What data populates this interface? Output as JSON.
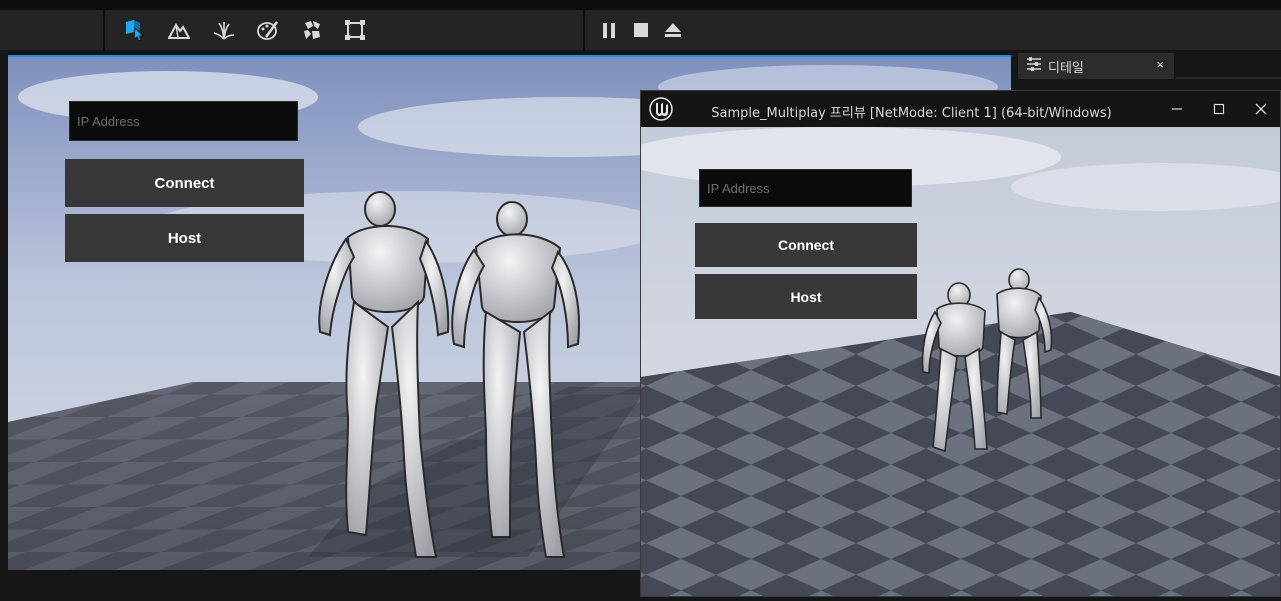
{
  "toolbar": {
    "modes": [
      {
        "icon": "select-mode-icon",
        "active": true
      },
      {
        "icon": "landscape-mode-icon",
        "active": false
      },
      {
        "icon": "foliage-mode-icon",
        "active": false
      },
      {
        "icon": "mesh-paint-mode-icon",
        "active": false
      },
      {
        "icon": "fracture-mode-icon",
        "active": false
      },
      {
        "icon": "geometry-edit-mode-icon",
        "active": false
      }
    ],
    "play_controls": [
      {
        "icon": "pause-icon"
      },
      {
        "icon": "stop-icon"
      },
      {
        "icon": "eject-icon"
      }
    ],
    "accent_color": "#1ea8f0"
  },
  "main_viewport": {
    "ip_placeholder": "IP Address",
    "connect_label": "Connect",
    "host_label": "Host"
  },
  "details_panel": {
    "tab_label": "디테일",
    "tab_icon": "details-sliders-icon",
    "close_glyph": "×"
  },
  "client_window": {
    "title": "Sample_Multiplay 프리뷰 [NetMode: Client 1]  (64-bit/Windows)",
    "logo_icon": "unreal-engine-logo-icon",
    "ip_placeholder": "IP Address",
    "connect_label": "Connect",
    "host_label": "Host",
    "controls": [
      "minimize-icon",
      "maximize-icon",
      "close-icon"
    ]
  }
}
